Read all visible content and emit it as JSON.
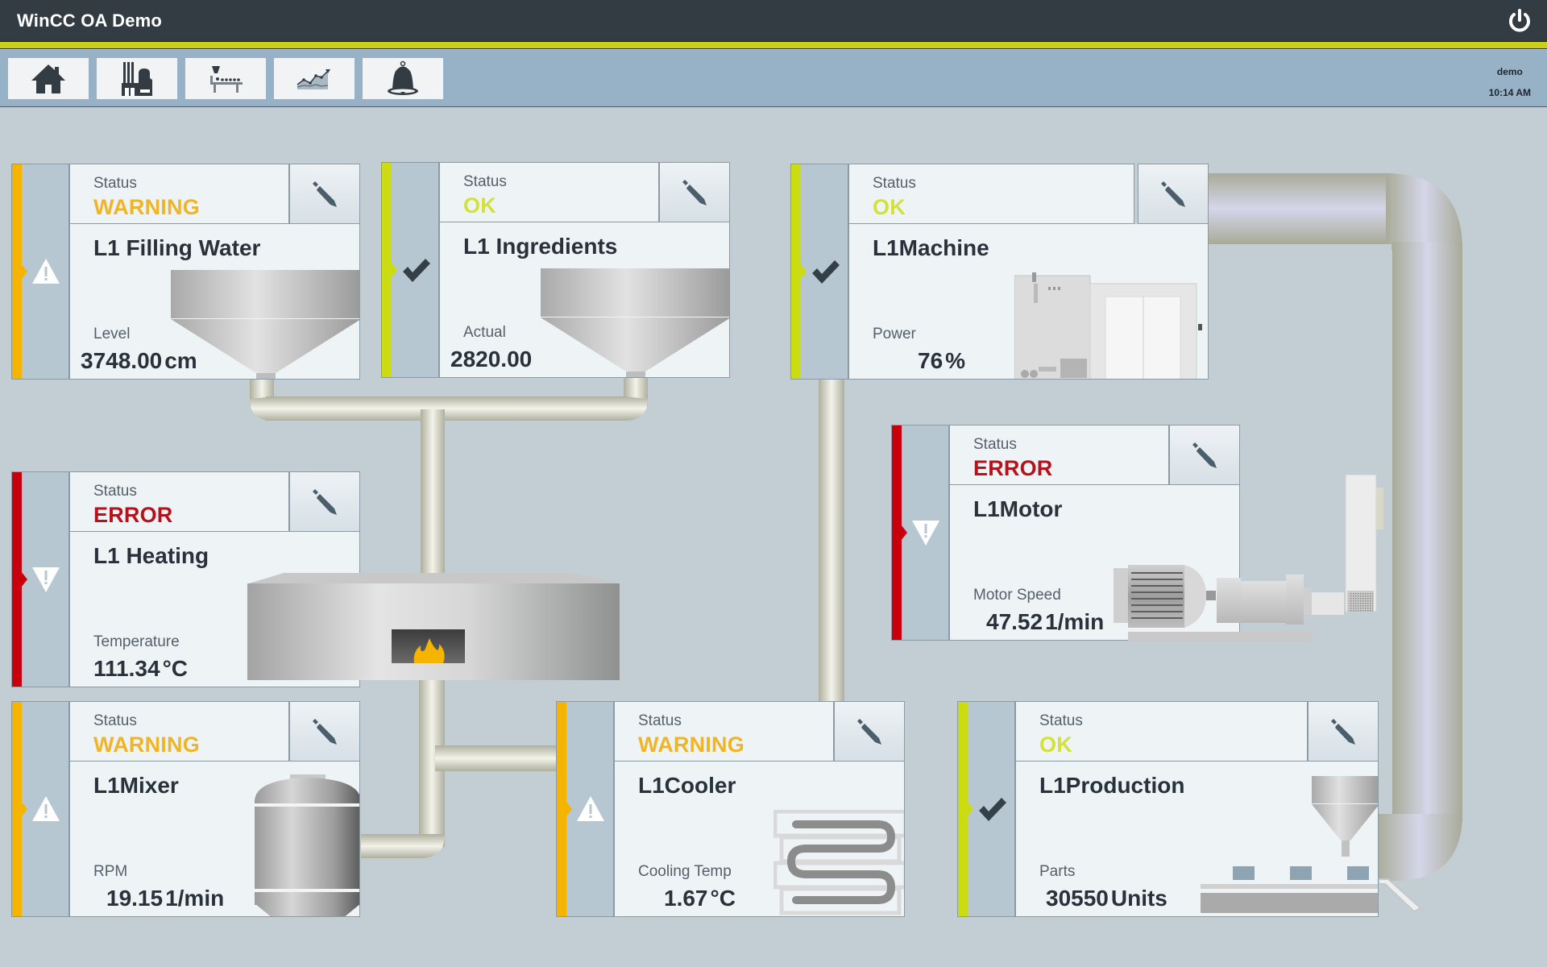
{
  "app": {
    "title": "WinCC OA Demo",
    "power_icon": "power-icon"
  },
  "nav": {
    "buttons": [
      {
        "id": "home",
        "icon": "home-icon"
      },
      {
        "id": "plant",
        "icon": "factory-icon"
      },
      {
        "id": "production-line",
        "icon": "conveyor-icon"
      },
      {
        "id": "trends",
        "icon": "trend-chart-icon"
      },
      {
        "id": "alarms",
        "icon": "bell-icon"
      }
    ],
    "user": "demo",
    "time": "10:14 AM"
  },
  "colors": {
    "warning": "#f5b400",
    "ok": "#cbdd12",
    "error": "#c8000d",
    "warning_text": "#f0b526",
    "ok_text": "#d3e23a",
    "error_text": "#b5121b"
  },
  "cards": {
    "filling_water": {
      "status_label": "Status",
      "status": "WARNING",
      "status_icon": "warning-triangle-icon",
      "name": "L1 Filling Water",
      "value_label": "Level",
      "value": "3748.00",
      "unit": "cm"
    },
    "ingredients": {
      "status_label": "Status",
      "status": "OK",
      "status_icon": "checkmark-icon",
      "name": "L1 Ingredients",
      "value_label": "Actual",
      "value": "2820.00",
      "unit": ""
    },
    "machine": {
      "status_label": "Status",
      "status": "OK",
      "status_icon": "checkmark-icon",
      "name": "L1Machine",
      "value_label": "Power",
      "value": "76",
      "unit": "%"
    },
    "heating": {
      "status_label": "Status",
      "status": "ERROR",
      "status_icon": "error-triangle-icon",
      "name": "L1 Heating",
      "value_label": "Temperature",
      "value": "111.34",
      "unit": "°C"
    },
    "motor": {
      "status_label": "Status",
      "status": "ERROR",
      "status_icon": "error-triangle-icon",
      "name": "L1Motor",
      "value_label": "Motor Speed",
      "value": "47.52",
      "unit": "1/min"
    },
    "mixer": {
      "status_label": "Status",
      "status": "WARNING",
      "status_icon": "warning-triangle-icon",
      "name": "L1Mixer",
      "value_label": "RPM",
      "value": "19.15",
      "unit": "1/min"
    },
    "cooler": {
      "status_label": "Status",
      "status": "WARNING",
      "status_icon": "warning-triangle-icon",
      "name": "L1Cooler",
      "value_label": "Cooling Temp",
      "value": "1.67",
      "unit": "°C"
    },
    "production": {
      "status_label": "Status",
      "status": "OK",
      "status_icon": "checkmark-icon",
      "name": "L1Production",
      "value_label": "Parts",
      "value": "30550",
      "unit": "Units"
    }
  }
}
